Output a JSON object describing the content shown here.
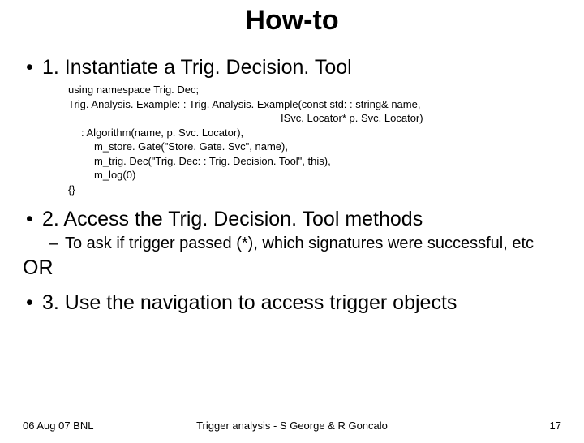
{
  "title": "How-to",
  "point1": "1. Instantiate a Trig. Decision. Tool",
  "code": {
    "l1": "using namespace Trig. Dec;",
    "l2": "Trig. Analysis. Example: : Trig. Analysis. Example(const std: : string& name,",
    "l3": "ISvc. Locator* p. Svc. Locator)",
    "l4": ": Algorithm(name, p. Svc. Locator),",
    "l5": "m_store. Gate(\"Store. Gate. Svc\", name),",
    "l6": "m_trig. Dec(\"Trig. Dec: : Trig. Decision. Tool\", this),",
    "l7": "m_log(0)",
    "l8": "{}"
  },
  "point2": "2. Access the Trig. Decision. Tool methods",
  "sub2": "To ask if trigger passed (*), which signatures were successful, etc",
  "or": "OR",
  "point3": "3. Use the navigation to access trigger objects",
  "footer": {
    "left": "06 Aug 07 BNL",
    "center": "Trigger analysis - S George & R Goncalo",
    "right": "17"
  }
}
